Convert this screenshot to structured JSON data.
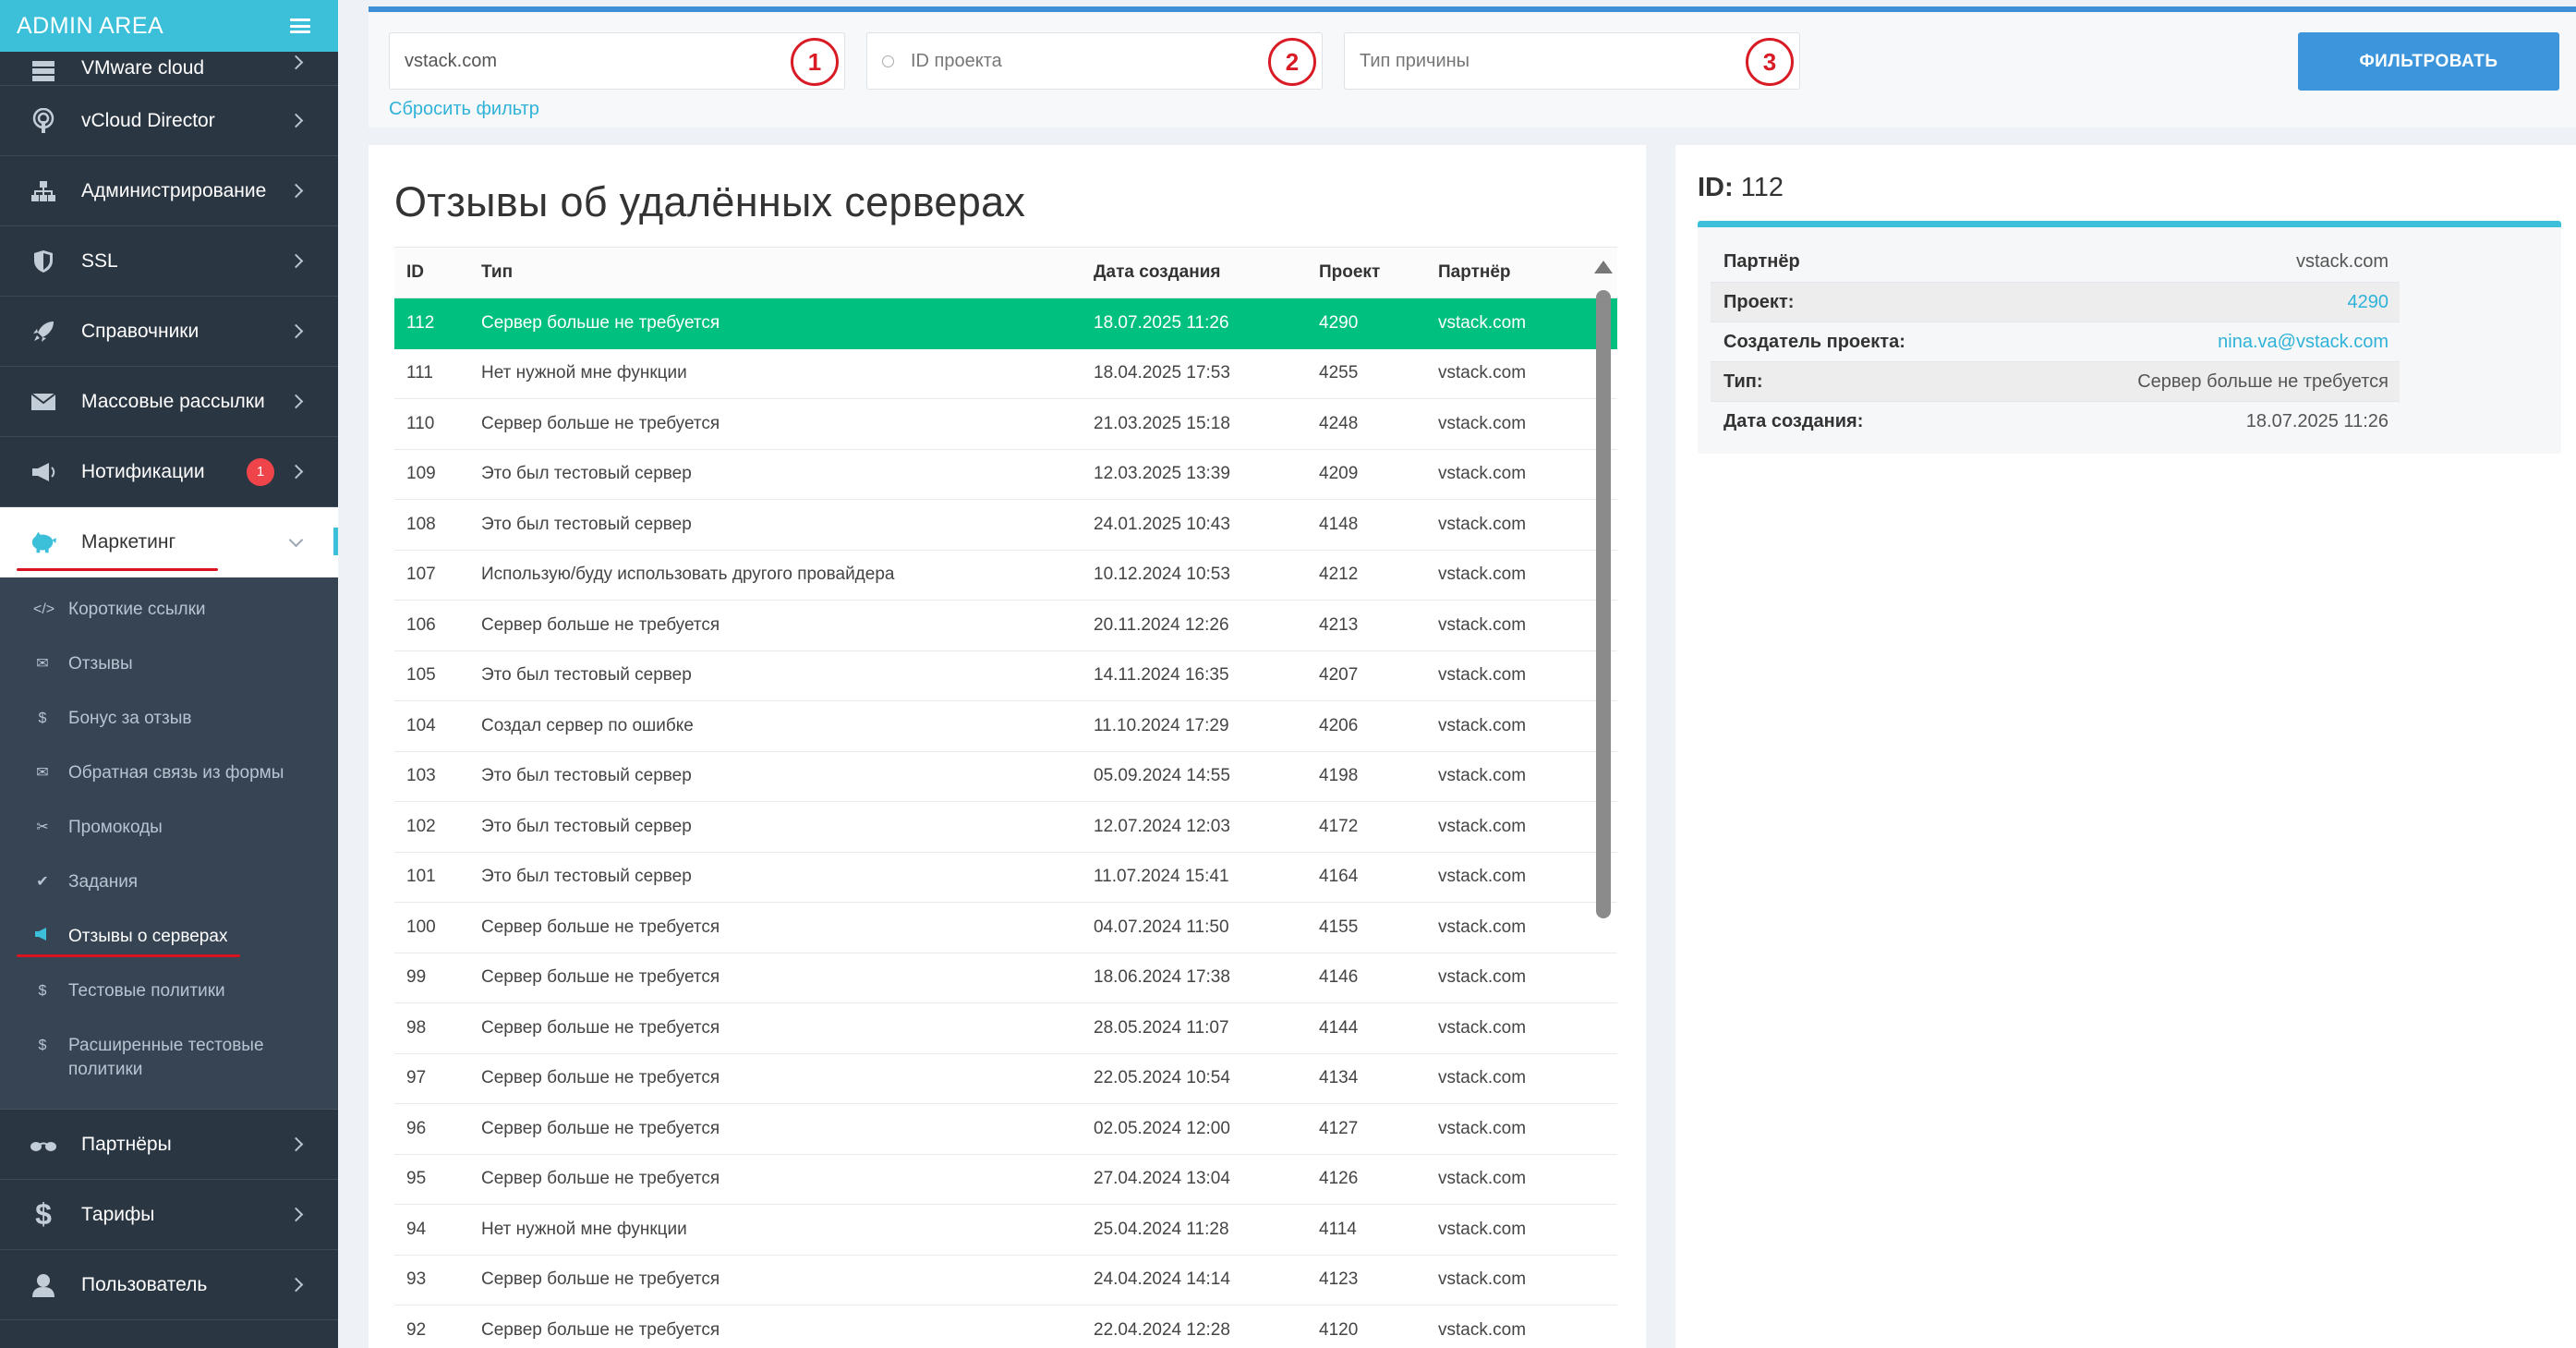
{
  "sidebar": {
    "title": "ADMIN AREA",
    "items_top": [
      {
        "label": "VMware cloud",
        "icon": "server-icon"
      },
      {
        "label": "vCloud Director",
        "icon": "podcast-icon"
      },
      {
        "label": "Администрирование",
        "icon": "sitemap-icon"
      },
      {
        "label": "SSL",
        "icon": "shield-icon"
      },
      {
        "label": "Справочники",
        "icon": "rocket-icon"
      },
      {
        "label": "Массовые рассылки",
        "icon": "envelope-icon"
      },
      {
        "label": "Нотификации",
        "icon": "bullhorn-icon",
        "badge": "1"
      }
    ],
    "active": {
      "label": "Маркетинг",
      "icon": "piggy-bank-icon"
    },
    "submenu": [
      {
        "label": "Короткие ссылки",
        "icon": "code-icon"
      },
      {
        "label": "Отзывы",
        "icon": "envelope-icon"
      },
      {
        "label": "Бонус за отзыв",
        "icon": "dollar-icon"
      },
      {
        "label": "Обратная связь из формы",
        "icon": "envelope-icon"
      },
      {
        "label": "Промокоды",
        "icon": "scissors-icon"
      },
      {
        "label": "Задания",
        "icon": "check-icon"
      },
      {
        "label": "Отзывы о серверах",
        "icon": "bullhorn-icon",
        "current": true
      },
      {
        "label": "Тестовые политики",
        "icon": "dollar-icon"
      },
      {
        "label": "Расширенные тестовые политики",
        "icon": "dollar-icon"
      }
    ],
    "items_bottom": [
      {
        "label": "Партнёры",
        "icon": "glasses-icon"
      },
      {
        "label": "Тарифы",
        "icon": "dollar-icon"
      },
      {
        "label": "Пользователь",
        "icon": "user-icon"
      }
    ]
  },
  "filters": {
    "partner_value": "vstack.com",
    "project_placeholder": "ID проекта",
    "reason_placeholder": "Тип причины",
    "markers": [
      "1",
      "2",
      "3"
    ],
    "reset_label": "Сбросить фильтр",
    "submit_label": "ФИЛЬТРОВАТЬ"
  },
  "table": {
    "title": "Отзывы об удалённых серверах",
    "columns": {
      "id": "ID",
      "type": "Тип",
      "date": "Дата создания",
      "project": "Проект",
      "partner": "Партнёр"
    },
    "rows": [
      {
        "id": "112",
        "type": "Сервер больше не требуется",
        "date": "18.07.2025 11:26",
        "project": "4290",
        "partner": "vstack.com"
      },
      {
        "id": "111",
        "type": "Нет нужной мне функции",
        "date": "18.04.2025 17:53",
        "project": "4255",
        "partner": "vstack.com"
      },
      {
        "id": "110",
        "type": "Сервер больше не требуется",
        "date": "21.03.2025 15:18",
        "project": "4248",
        "partner": "vstack.com"
      },
      {
        "id": "109",
        "type": "Это был тестовый сервер",
        "date": "12.03.2025 13:39",
        "project": "4209",
        "partner": "vstack.com"
      },
      {
        "id": "108",
        "type": "Это был тестовый сервер",
        "date": "24.01.2025 10:43",
        "project": "4148",
        "partner": "vstack.com"
      },
      {
        "id": "107",
        "type": "Использую/буду использовать другого провайдера",
        "date": "10.12.2024 10:53",
        "project": "4212",
        "partner": "vstack.com"
      },
      {
        "id": "106",
        "type": "Сервер больше не требуется",
        "date": "20.11.2024 12:26",
        "project": "4213",
        "partner": "vstack.com"
      },
      {
        "id": "105",
        "type": "Это был тестовый сервер",
        "date": "14.11.2024 16:35",
        "project": "4207",
        "partner": "vstack.com"
      },
      {
        "id": "104",
        "type": "Создал сервер по ошибке",
        "date": "11.10.2024 17:29",
        "project": "4206",
        "partner": "vstack.com"
      },
      {
        "id": "103",
        "type": "Это был тестовый сервер",
        "date": "05.09.2024 14:55",
        "project": "4198",
        "partner": "vstack.com"
      },
      {
        "id": "102",
        "type": "Это был тестовый сервер",
        "date": "12.07.2024 12:03",
        "project": "4172",
        "partner": "vstack.com"
      },
      {
        "id": "101",
        "type": "Это был тестовый сервер",
        "date": "11.07.2024 15:41",
        "project": "4164",
        "partner": "vstack.com"
      },
      {
        "id": "100",
        "type": "Сервер больше не требуется",
        "date": "04.07.2024 11:50",
        "project": "4155",
        "partner": "vstack.com"
      },
      {
        "id": "99",
        "type": "Сервер больше не требуется",
        "date": "18.06.2024 17:38",
        "project": "4146",
        "partner": "vstack.com"
      },
      {
        "id": "98",
        "type": "Сервер больше не требуется",
        "date": "28.05.2024 11:07",
        "project": "4144",
        "partner": "vstack.com"
      },
      {
        "id": "97",
        "type": "Сервер больше не требуется",
        "date": "22.05.2024 10:54",
        "project": "4134",
        "partner": "vstack.com"
      },
      {
        "id": "96",
        "type": "Сервер больше не требуется",
        "date": "02.05.2024 12:00",
        "project": "4127",
        "partner": "vstack.com"
      },
      {
        "id": "95",
        "type": "Сервер больше не требуется",
        "date": "27.04.2024 13:04",
        "project": "4126",
        "partner": "vstack.com"
      },
      {
        "id": "94",
        "type": "Нет нужной мне функции",
        "date": "25.04.2024 11:28",
        "project": "4114",
        "partner": "vstack.com"
      },
      {
        "id": "93",
        "type": "Сервер больше не требуется",
        "date": "24.04.2024 14:14",
        "project": "4123",
        "partner": "vstack.com"
      },
      {
        "id": "92",
        "type": "Сервер больше не требуется",
        "date": "22.04.2024 12:28",
        "project": "4120",
        "partner": "vstack.com"
      }
    ]
  },
  "detail": {
    "id_label": "ID:",
    "id_value": "112",
    "fields": [
      {
        "key": "Партнёр",
        "value": "vstack.com"
      },
      {
        "key": "Проект:",
        "value": "4290",
        "link": true
      },
      {
        "key": "Создатель проекта:",
        "value": "nina.va@vstack.com",
        "link": true
      },
      {
        "key": "Тип:",
        "value": "Сервер больше не требуется"
      },
      {
        "key": "Дата создания:",
        "value": "18.07.2025 11:26"
      }
    ]
  },
  "colors": {
    "accent": "#3cc0d9",
    "selected_row": "#00c07f",
    "button": "#3d96db",
    "marker": "#d81b24",
    "sidebar": "#2b3643"
  }
}
